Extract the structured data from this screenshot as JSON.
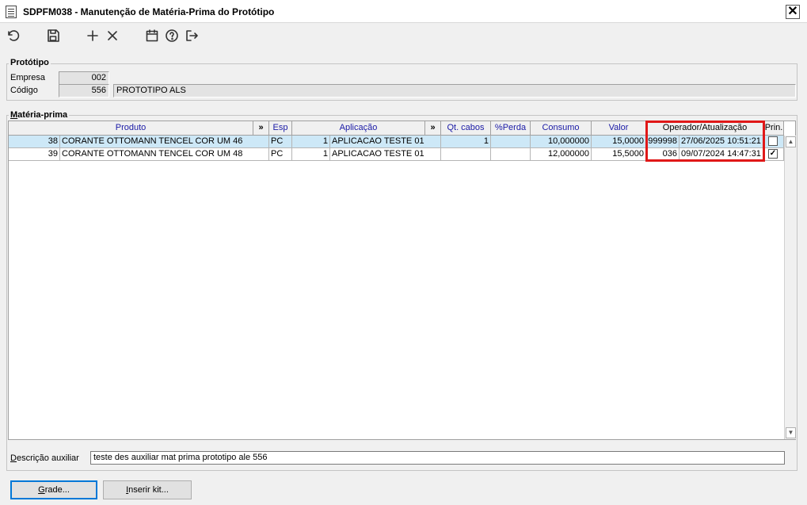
{
  "window": {
    "title": "SDPFM038 - Manutenção de Matéria-Prima do Protótipo",
    "close_label": "✕"
  },
  "toolbar": {
    "icons": [
      "refresh-icon",
      "save-icon",
      "add-icon",
      "delete-icon",
      "calendar-icon",
      "help-icon",
      "exit-icon"
    ]
  },
  "prototipo": {
    "group_label": "Protótipo",
    "empresa_label": "Empresa",
    "empresa_value": "002",
    "codigo_label": "Código",
    "codigo_value": "556",
    "descricao_value": "PROTOTIPO ALS"
  },
  "materia_prima": {
    "group_label": "Matéria-prima",
    "headers": {
      "produto": "Produto",
      "expand1": "»",
      "esp": "Esp",
      "aplicacao": "Aplicação",
      "expand2": "»",
      "qt_cabos": "Qt. cabos",
      "perda": "%Perda",
      "consumo": "Consumo",
      "valor": "Valor",
      "operador": "Operador/Atualização",
      "prin": "Prin."
    },
    "rows": [
      {
        "cod": "38",
        "produto": "CORANTE OTTOMANN TENCEL COR UM 46",
        "esp": "PC",
        "apl_cod": "1",
        "aplicacao": "APLICACAO TESTE 01",
        "qt_cabos": "1",
        "perda": "",
        "consumo": "10,000000",
        "valor": "15,0000",
        "operador": "999998",
        "atualizacao": "27/06/2025 10:51:21",
        "prin": false
      },
      {
        "cod": "39",
        "produto": "CORANTE OTTOMANN TENCEL COR UM 48",
        "esp": "PC",
        "apl_cod": "1",
        "aplicacao": "APLICACAO TESTE 01",
        "qt_cabos": "",
        "perda": "",
        "consumo": "12,000000",
        "valor": "15,5000",
        "operador": "036",
        "atualizacao": "09/07/2024 14:47:31",
        "prin": true
      }
    ]
  },
  "descricao_auxiliar": {
    "label": "Descrição auxiliar",
    "value": "teste des auxiliar mat prima prototipo ale 556"
  },
  "buttons": {
    "grade": "Grade...",
    "inserir_kit": "Inserir kit..."
  },
  "colors": {
    "highlight": "#e01818",
    "selected_row": "#cde8f7",
    "header_text": "#1a1aa6"
  }
}
